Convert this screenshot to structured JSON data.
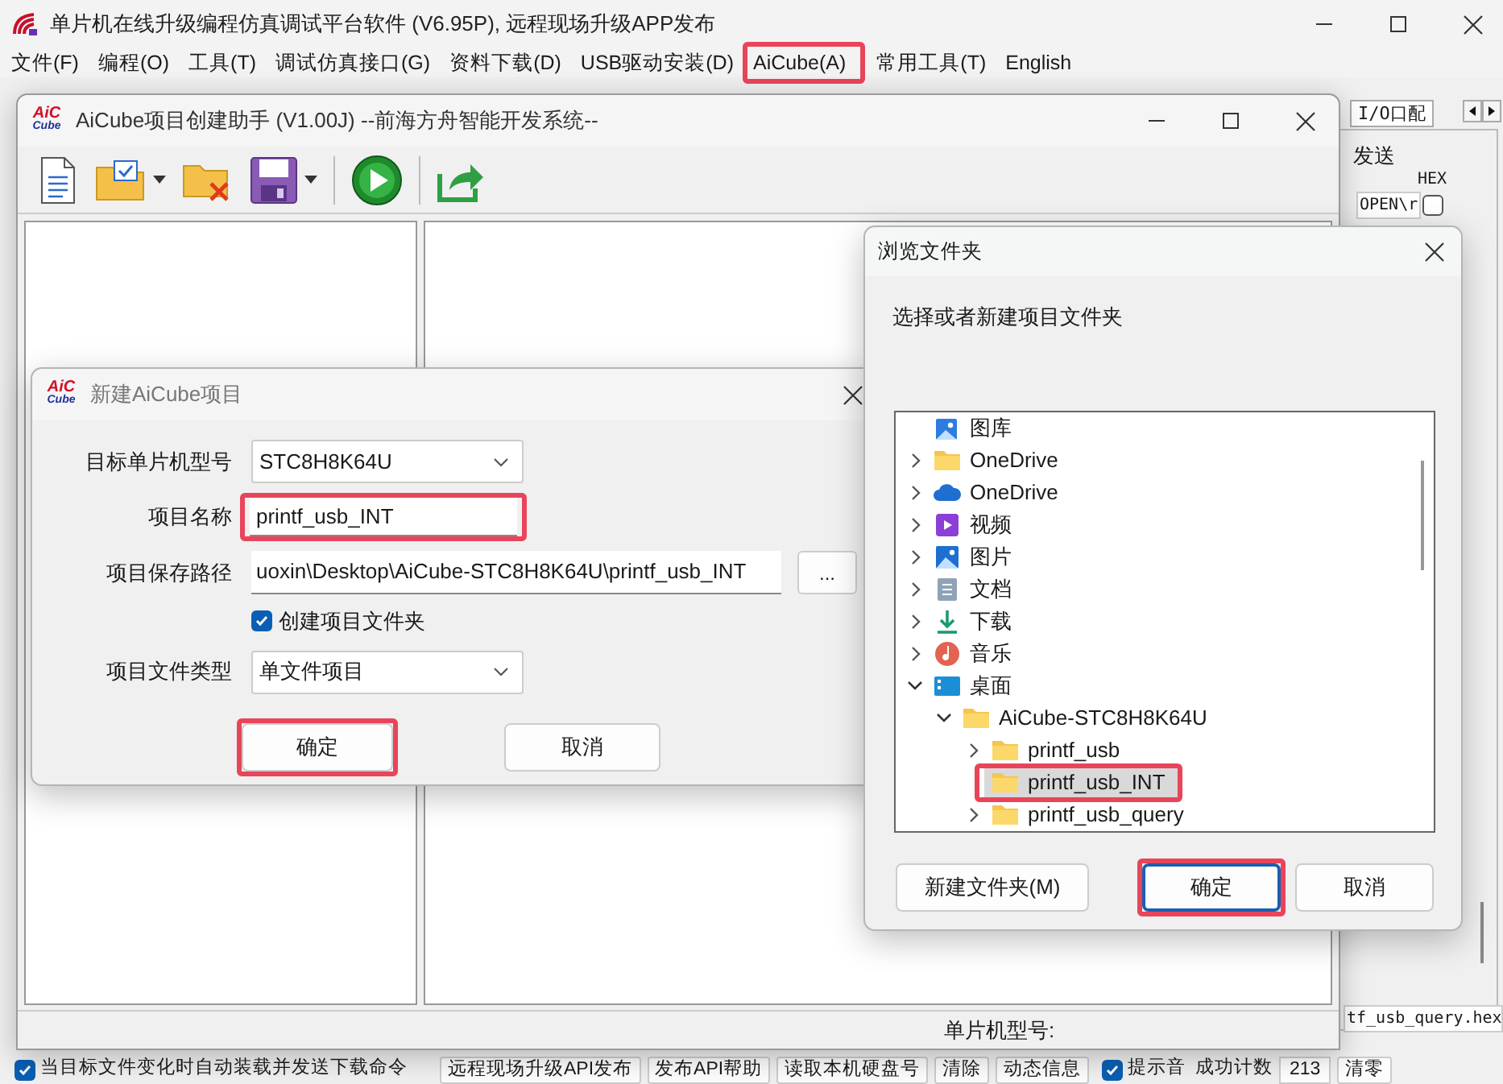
{
  "main_window": {
    "title": "单片机在线升级编程仿真调试平台软件 (V6.95P), 远程现场升级APP发布",
    "menu": [
      {
        "label": "文件(F)",
        "highlighted": false
      },
      {
        "label": "编程(O)",
        "highlighted": false
      },
      {
        "label": "工具(T)",
        "highlighted": false
      },
      {
        "label": "调试仿真接口(G)",
        "highlighted": false
      },
      {
        "label": "资料下载(D)",
        "highlighted": false
      },
      {
        "label": "USB驱动安装(D)",
        "highlighted": false
      },
      {
        "label": "AiCube(A)",
        "highlighted": true
      },
      {
        "label": "常用工具(T)",
        "highlighted": false
      },
      {
        "label": "English",
        "highlighted": false
      }
    ]
  },
  "side_panel": {
    "tab": "I/O口配",
    "group_title": "发送",
    "hex_label": "HEX",
    "open_button": "OPEN\\r",
    "hex_checked": false,
    "file_name": "tf_usb_query.hex"
  },
  "bottom_bar": {
    "auto_reload": {
      "label": "当目标文件变化时自动装载并发送下载命令",
      "checked": true
    },
    "buttons": [
      "远程现场升级API发布",
      "发布API帮助",
      "读取本机硬盘号",
      "清除",
      "动态信息"
    ],
    "beep": {
      "label": "提示音",
      "checked": true
    },
    "count_label": "成功计数",
    "count": "213",
    "reset_button": "清零"
  },
  "aicube_window": {
    "logo": [
      "AiC",
      "Cube"
    ],
    "title": "AiCube项目创建助手 (V1.00J) --前海方舟智能开发系统--",
    "status_label": "单片机型号:"
  },
  "new_project_dialog": {
    "logo": [
      "AiC",
      "Cube"
    ],
    "title": "新建AiCube项目",
    "fields": [
      {
        "kind": "select",
        "label": "目标单片机型号",
        "value": "STC8H8K64U",
        "highlighted": false
      },
      {
        "kind": "text",
        "label": "项目名称",
        "value": "printf_usb_INT",
        "highlighted": true
      },
      {
        "kind": "path",
        "label": "项目保存路径",
        "value": "uoxin\\Desktop\\AiCube-STC8H8K64U\\printf_usb_INT",
        "button": "...",
        "highlighted": false
      },
      {
        "kind": "checkbox",
        "label": "创建项目文件夹",
        "checked": true,
        "highlighted": false
      },
      {
        "kind": "select",
        "label": "项目文件类型",
        "value": "单文件项目",
        "highlighted": false
      }
    ],
    "buttons": [
      {
        "label": "确定",
        "highlighted": true
      },
      {
        "label": "取消",
        "highlighted": false
      }
    ]
  },
  "browse_dialog": {
    "title": "浏览文件夹",
    "prompt": "选择或者新建项目文件夹",
    "tree": [
      {
        "kind": "gallery",
        "label": "图库",
        "selected": false,
        "highlighted": false
      },
      {
        "kind": "folder",
        "label": "OneDrive",
        "expanded": false,
        "selected": false,
        "highlighted": false
      },
      {
        "kind": "cloud",
        "label": "OneDrive",
        "expanded": false,
        "selected": false,
        "highlighted": false
      },
      {
        "kind": "video",
        "label": "视频",
        "expanded": false,
        "selected": false,
        "highlighted": false
      },
      {
        "kind": "pictures",
        "label": "图片",
        "expanded": false,
        "selected": false,
        "highlighted": false
      },
      {
        "kind": "documents",
        "label": "文档",
        "expanded": false,
        "selected": false,
        "highlighted": false
      },
      {
        "kind": "downloads",
        "label": "下载",
        "expanded": false,
        "selected": false,
        "highlighted": false
      },
      {
        "kind": "music",
        "label": "音乐",
        "expanded": false,
        "selected": false,
        "highlighted": false
      },
      {
        "kind": "desktop",
        "label": "桌面",
        "expanded": true,
        "selected": false,
        "highlighted": false,
        "children": [
          {
            "kind": "folder",
            "label": "AiCube-STC8H8K64U",
            "expanded": true,
            "selected": false,
            "highlighted": false,
            "children": [
              {
                "kind": "folder",
                "label": "printf_usb",
                "expanded": false,
                "selected": false,
                "highlighted": false
              },
              {
                "kind": "folder",
                "label": "printf_usb_INT",
                "selected": true,
                "highlighted": true
              },
              {
                "kind": "folder",
                "label": "printf_usb_query",
                "expanded": false,
                "selected": false,
                "highlighted": false
              }
            ]
          }
        ]
      }
    ],
    "buttons": [
      {
        "label": "新建文件夹(M)",
        "highlighted": false,
        "default": false
      },
      {
        "label": "确定",
        "highlighted": true,
        "default": true
      },
      {
        "label": "取消",
        "highlighted": false,
        "default": false
      }
    ]
  }
}
